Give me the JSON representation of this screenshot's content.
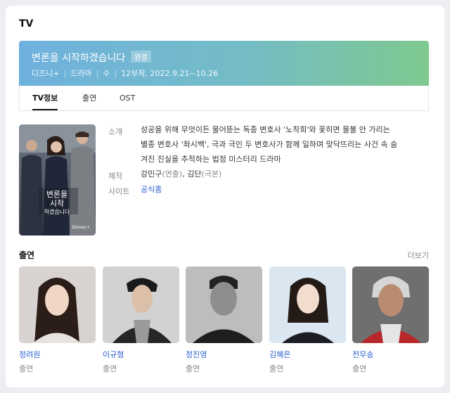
{
  "section_title": "TV",
  "show": {
    "title": "변론을 시작하겠습니다",
    "badge": "완결",
    "meta": [
      "디즈니+",
      "드라마",
      "수",
      "12부작, 2022.9.21~10.26"
    ]
  },
  "tabs": [
    {
      "label": "TV정보",
      "active": true
    },
    {
      "label": "출연",
      "active": false
    },
    {
      "label": "OST",
      "active": false
    }
  ],
  "poster": {
    "title_text": "변론을 시작하겠습니다",
    "brand": "Disney+"
  },
  "info": {
    "synopsis_label": "소개",
    "synopsis_lines": [
      "성공을 위해 무엇이든 물어뜯는 독종 변호사 '노착희'와 꽃히면 물불 안 가리는",
      "별종 변호사 '좌시백', 극과 극인 두 변호사가 함께 일하며 맞닥뜨리는 사건 속 숨",
      "겨진 진실을 추적하는 법정 미스터리 드라마"
    ],
    "production_label": "제작",
    "producers": [
      {
        "name": "강민구",
        "role": "(연출)"
      },
      {
        "name": "김단",
        "role": "(극본)"
      }
    ],
    "production_sep": ", ",
    "site_label": "사이트",
    "site_link": "공식홈"
  },
  "cast": {
    "title": "출연",
    "more_label": "더보기",
    "members": [
      {
        "name": "정려원",
        "role": "출연"
      },
      {
        "name": "이규형",
        "role": "출연"
      },
      {
        "name": "정진영",
        "role": "출연"
      },
      {
        "name": "김혜은",
        "role": "출연"
      },
      {
        "name": "전무송",
        "role": "출연"
      }
    ]
  }
}
